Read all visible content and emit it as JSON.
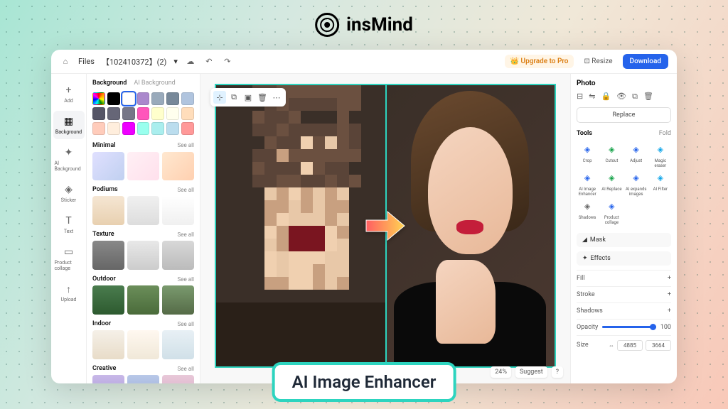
{
  "brand": "insMind",
  "badge_text": "AI Image Enhancer",
  "topbar": {
    "files": "Files",
    "filename": "【102410372】(2)",
    "upgrade": "👑 Upgrade to Pro",
    "resize": "⊡ Resize",
    "download": "Download"
  },
  "rail": [
    {
      "icon": "+",
      "label": "Add"
    },
    {
      "icon": "▦",
      "label": "Background"
    },
    {
      "icon": "✦",
      "label": "AI Background"
    },
    {
      "icon": "◈",
      "label": "Sticker"
    },
    {
      "icon": "T",
      "label": "Text"
    },
    {
      "icon": "▭",
      "label": "Product collage"
    },
    {
      "icon": "↑",
      "label": "Upload"
    }
  ],
  "bg_tabs": {
    "a": "Background",
    "b": "AI Background"
  },
  "swatches": [
    "rainbow",
    "#000",
    "#fff",
    "#a8c",
    "#9ab",
    "#789",
    "#b0c4de",
    "#556",
    "#667",
    "#778",
    "#f5b",
    "#ffc",
    "#ffe",
    "#fdb",
    "#fcb",
    "#fed",
    "#e0f",
    "#9fe",
    "#aee",
    "#bde",
    "#f99"
  ],
  "cats": [
    {
      "name": "Minimal",
      "thumbs": [
        "linear-gradient(135deg,#e0e0ff,#c0d0f0)",
        "linear-gradient(135deg,#fff0f5,#ffe0ec)",
        "linear-gradient(135deg,#ffe8d0,#ffd0b0)"
      ]
    },
    {
      "name": "Podiums",
      "thumbs": [
        "linear-gradient(#f5e6d3,#e8d0b0)",
        "linear-gradient(#f0f0f0,#ddd)",
        "linear-gradient(#fff,#f0f0f0)"
      ]
    },
    {
      "name": "Texture",
      "thumbs": [
        "linear-gradient(#888,#666)",
        "linear-gradient(#e8e8e8,#ccc)",
        "linear-gradient(#d8d8d8,#bbb)"
      ]
    },
    {
      "name": "Outdoor",
      "thumbs": [
        "linear-gradient(#4a7c4e,#2d5a2f)",
        "linear-gradient(#6b8e5a,#4a6b3a)",
        "linear-gradient(#7a9a6e,#556b47)"
      ]
    },
    {
      "name": "Indoor",
      "thumbs": [
        "linear-gradient(#f5f0e8,#e8dcc8)",
        "linear-gradient(#fff8f0,#f0e8d8)",
        "linear-gradient(#e8f0f5,#d0e0e8)"
      ]
    },
    {
      "name": "Creative",
      "thumbs": [
        "linear-gradient(#c8b8e8,#a898d8)",
        "linear-gradient(#b8c8e8,#98a8d8)",
        "linear-gradient(#e8c8d8,#d8a8c8)"
      ]
    }
  ],
  "seeall": "See all",
  "bottombar": {
    "zoom": "24%",
    "suggest": "Suggest",
    "help": "?"
  },
  "right": {
    "title": "Photo",
    "replace": "Replace",
    "tools_label": "Tools",
    "fold": "Fold",
    "tools": [
      {
        "label": "Crop",
        "color": "#2563eb"
      },
      {
        "label": "Cutout",
        "color": "#16a34a"
      },
      {
        "label": "Adjust",
        "color": "#2563eb"
      },
      {
        "label": "Magic eraser",
        "color": "#0ea5e9"
      },
      {
        "label": "AI Image Enhancer",
        "color": "#2563eb"
      },
      {
        "label": "AI Replace",
        "color": "#16a34a"
      },
      {
        "label": "AI expands images",
        "color": "#2563eb"
      },
      {
        "label": "AI Filter",
        "color": "#0ea5e9"
      },
      {
        "label": "Shadows",
        "color": "#666"
      },
      {
        "label": "Product collage",
        "color": "#2563eb"
      }
    ],
    "mask": "Mask",
    "effects": "Effects",
    "fill": "Fill",
    "stroke": "Stroke",
    "shadows": "Shadows",
    "opacity": "Opacity",
    "opacity_val": "100",
    "size": "Size",
    "w": "4885",
    "h": "3664"
  }
}
